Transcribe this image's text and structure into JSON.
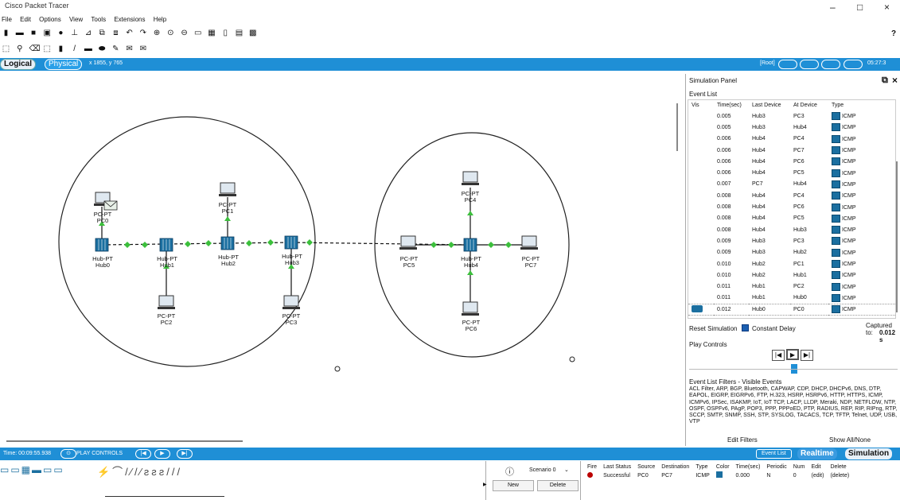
{
  "window": {
    "title": "Cisco Packet Tracer",
    "min": "–",
    "restore": "□",
    "close": "×"
  },
  "menu": [
    "File",
    "Edit",
    "Options",
    "View",
    "Tools",
    "Extensions",
    "Help"
  ],
  "help_mark": "?",
  "workspace": {
    "logical_tab": "Logical",
    "physical_tab": "Physical",
    "coords": "x 1855, y 765",
    "root": "[Root]",
    "clock": "05:27:3"
  },
  "devices": [
    {
      "id": "hub0",
      "l1": "Hub-PT",
      "l2": "Hub0"
    },
    {
      "id": "hub1",
      "l1": "Hub-PT",
      "l2": "Hub1"
    },
    {
      "id": "hub2",
      "l1": "Hub-PT",
      "l2": "Hub2"
    },
    {
      "id": "hub3",
      "l1": "Hub-PT",
      "l2": "Hub3"
    },
    {
      "id": "hub4",
      "l1": "Hub-PT",
      "l2": "Hub4"
    },
    {
      "id": "pc0",
      "l1": "PC-PT",
      "l2": "PC0"
    },
    {
      "id": "pc1",
      "l1": "PC-PT",
      "l2": "PC1"
    },
    {
      "id": "pc2",
      "l1": "PC-PT",
      "l2": "PC2"
    },
    {
      "id": "pc3",
      "l1": "PC-PT",
      "l2": "PC3"
    },
    {
      "id": "pc4",
      "l1": "PC-PT",
      "l2": "PC4"
    },
    {
      "id": "pc5",
      "l1": "PC-PT",
      "l2": "PC5"
    },
    {
      "id": "pc6",
      "l1": "PC-PT",
      "l2": "PC6"
    },
    {
      "id": "pc7",
      "l1": "PC-PT",
      "l2": "PC7"
    }
  ],
  "sim": {
    "title": "Simulation Panel",
    "event_list_label": "Event List",
    "columns": [
      "Vis",
      "Time(sec)",
      "Last Device",
      "At Device",
      "Type"
    ],
    "events": [
      {
        "time": "0.005",
        "last": "Hub3",
        "at": "PC3",
        "type": "ICMP"
      },
      {
        "time": "0.005",
        "last": "Hub3",
        "at": "Hub4",
        "type": "ICMP"
      },
      {
        "time": "0.006",
        "last": "Hub4",
        "at": "PC4",
        "type": "ICMP"
      },
      {
        "time": "0.006",
        "last": "Hub4",
        "at": "PC7",
        "type": "ICMP"
      },
      {
        "time": "0.006",
        "last": "Hub4",
        "at": "PC6",
        "type": "ICMP"
      },
      {
        "time": "0.006",
        "last": "Hub4",
        "at": "PC5",
        "type": "ICMP"
      },
      {
        "time": "0.007",
        "last": "PC7",
        "at": "Hub4",
        "type": "ICMP"
      },
      {
        "time": "0.008",
        "last": "Hub4",
        "at": "PC4",
        "type": "ICMP"
      },
      {
        "time": "0.008",
        "last": "Hub4",
        "at": "PC6",
        "type": "ICMP"
      },
      {
        "time": "0.008",
        "last": "Hub4",
        "at": "PC5",
        "type": "ICMP"
      },
      {
        "time": "0.008",
        "last": "Hub4",
        "at": "Hub3",
        "type": "ICMP"
      },
      {
        "time": "0.009",
        "last": "Hub3",
        "at": "PC3",
        "type": "ICMP"
      },
      {
        "time": "0.009",
        "last": "Hub3",
        "at": "Hub2",
        "type": "ICMP"
      },
      {
        "time": "0.010",
        "last": "Hub2",
        "at": "PC1",
        "type": "ICMP"
      },
      {
        "time": "0.010",
        "last": "Hub2",
        "at": "Hub1",
        "type": "ICMP"
      },
      {
        "time": "0.011",
        "last": "Hub1",
        "at": "PC2",
        "type": "ICMP"
      },
      {
        "time": "0.011",
        "last": "Hub1",
        "at": "Hub0",
        "type": "ICMP"
      },
      {
        "time": "0.012",
        "last": "Hub0",
        "at": "PC0",
        "type": "ICMP",
        "selected": true
      }
    ],
    "reset_label": "Reset Simulation",
    "constant_delay": "Constant Delay",
    "captured_label": "Captured to:",
    "captured_value": "0.012 s",
    "play_controls": "Play Controls",
    "filters_label": "Event List Filters - Visible Events",
    "filters_text": "ACL Filter, ARP, BGP, Bluetooth, CAPWAP, CDP, DHCP, DHCPv6, DNS, DTP, EAPOL, EIGRP, EIGRPv6, FTP, H.323, HSRP, HSRPv6, HTTP, HTTPS, ICMP, ICMPv6, IPSec, ISAKMP, IoT, IoT TCP, LACP, LLDP, Meraki, NDP, NETFLOW, NTP, OSPF, OSPFv6, PAgP, POP3, PPP, PPPoED, PTP, RADIUS, REP, RIP, RIPng, RTP, SCCP, SMTP, SNMP, SSH, STP, SYSLOG, TACACS, TCP, TFTP, Telnet, UDP, USB, VTP",
    "edit_filters": "Edit Filters",
    "show_all": "Show All/None"
  },
  "bottom": {
    "time": "Time: 00:09:55.938",
    "play_controls": "PLAY CONTROLS",
    "event_list_btn": "Event List",
    "realtime_btn": "Realtime",
    "simulation_btn": "Simulation",
    "scenario": "Scenario 0",
    "new_btn": "New",
    "delete_btn": "Delete",
    "pdu_columns": [
      "Fire",
      "Last Status",
      "Source",
      "Destination",
      "Type",
      "Color",
      "Time(sec)",
      "Periodic",
      "Num",
      "Edit",
      "Delete"
    ],
    "pdu_row": {
      "status": "Successful",
      "source": "PC0",
      "dest": "PC7",
      "type": "ICMP",
      "time": "0.000",
      "periodic": "N",
      "num": "0",
      "edit": "(edit)",
      "delete": "(delete)"
    }
  },
  "colors": {
    "accent": "#1f8fd6",
    "link_dot": "#3cbf3c",
    "hub": "#1b6fa0"
  }
}
